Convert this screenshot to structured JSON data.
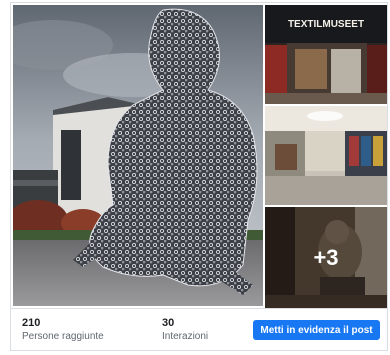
{
  "photos": {
    "main": {
      "description": "sculpture"
    },
    "second": {
      "sign_text": "TEXTILMUSEET"
    },
    "more_count_label": "+3"
  },
  "stats": {
    "reach_value": "210",
    "reach_label": "Persone raggiunte",
    "interactions_value": "30",
    "interactions_label": "Interazioni"
  },
  "boost_button_label": "Metti in evidenza il post",
  "colors": {
    "button_blue": "#1877f2",
    "primary_text": "#1c1e21",
    "secondary_text": "#606770",
    "border": "#dadde1"
  }
}
